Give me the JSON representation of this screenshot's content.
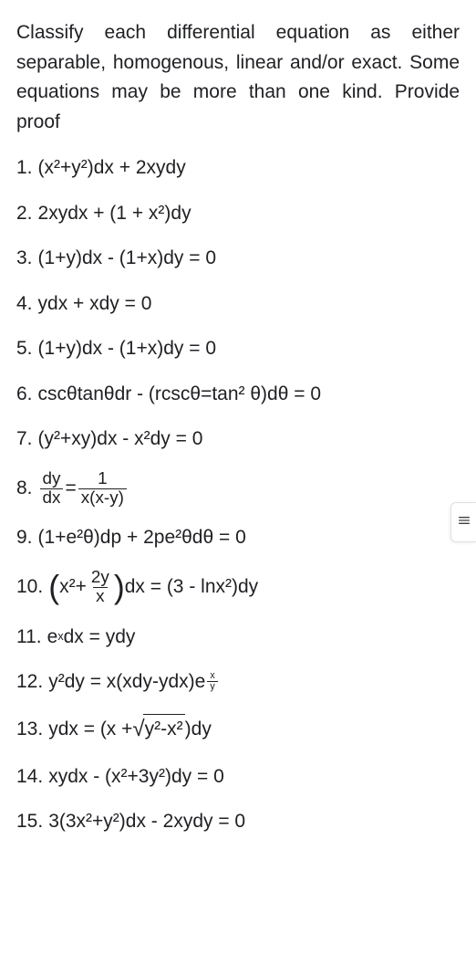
{
  "intro": "Classify each differential equation as either separable, homogenous, linear and/or exact. Some equations may be more than one kind. Provide proof",
  "problems": [
    {
      "n": "1.",
      "math": "(x²+y²)dx + 2xydy"
    },
    {
      "n": "2.",
      "math": "2xydx + (1 + x²)dy"
    },
    {
      "n": "3.",
      "math": "(1+y)dx - (1+x)dy = 0"
    },
    {
      "n": "4.",
      "math": "ydx + xdy = 0"
    },
    {
      "n": "5.",
      "math": "(1+y)dx - (1+x)dy = 0"
    },
    {
      "n": "6.",
      "math": "cscθtanθdr - (rcscθ=tan² θ)dθ = 0"
    },
    {
      "n": "7.",
      "math": "(y²+xy)dx - x²dy = 0"
    },
    {
      "n": "8.",
      "frac_left_n": "dy",
      "frac_left_d": "dx",
      "mid": " = ",
      "frac_right_n": "1",
      "frac_right_d": "x(x-y)"
    },
    {
      "n": "9.",
      "math": "(1+e²θ)dp + 2pe²θdθ = 0"
    },
    {
      "n": "10.",
      "pre": "x²+",
      "frac_n": "2y",
      "frac_d": "x",
      "post": "dx = (3 - lnx²)dy"
    },
    {
      "n": "11.",
      "pre": "e",
      "sup": "x",
      "post": "dx = ydy"
    },
    {
      "n": "12.",
      "pre": "y²dy = x(xdy-ydx)e",
      "expfrac_n": "x",
      "expfrac_d": "y"
    },
    {
      "n": "13.",
      "pre": "ydx = (x + ",
      "rad": "y²-x²",
      "post": ")dy"
    },
    {
      "n": "14.",
      "math": "xydx - (x²+3y²)dy = 0"
    },
    {
      "n": "15.",
      "math": "3(3x²+y²)dx - 2xydy = 0"
    }
  ],
  "sidebar": {
    "icon": "menu-icon"
  }
}
